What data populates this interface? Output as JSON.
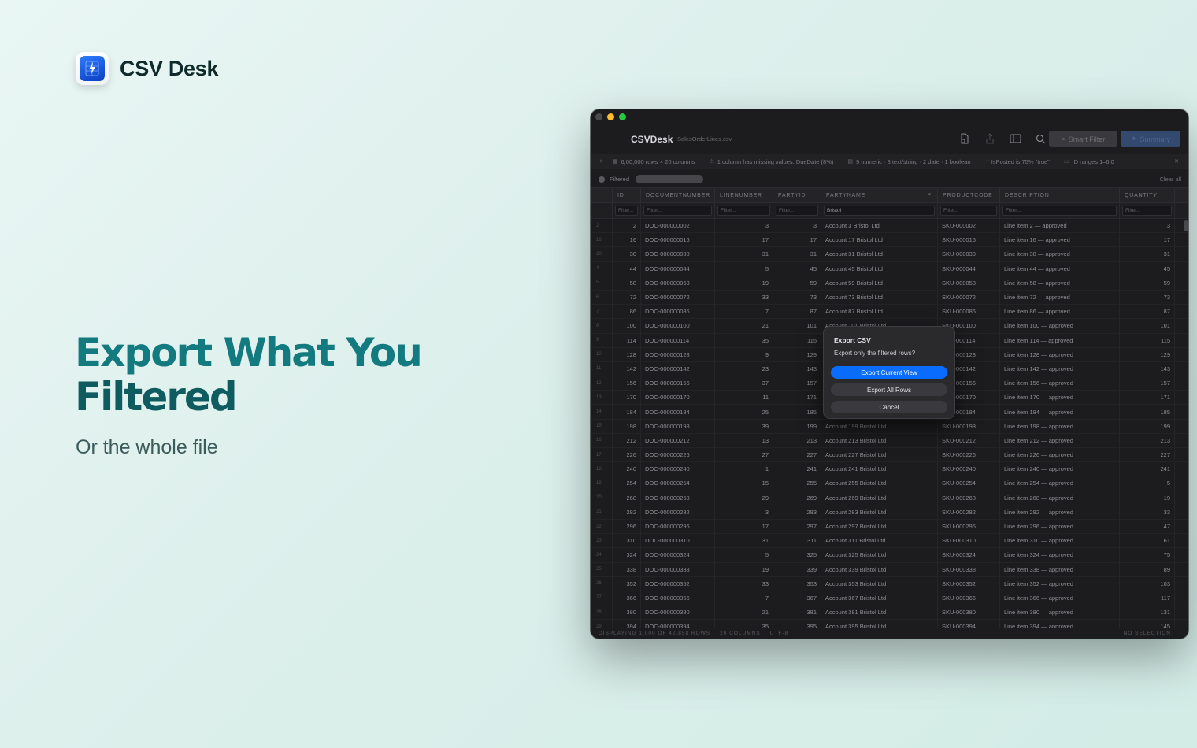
{
  "brand": {
    "name": "CSV Desk",
    "icon": "lightning-spreadsheet-icon"
  },
  "hero": {
    "title_line1": "Export What You",
    "title_line2": "Filtered",
    "subtitle": "Or the whole file"
  },
  "window": {
    "app_title": "CSVDesk",
    "file_name": "SalesOrderLines.csv",
    "toolbar": {
      "smart_filter_label": "Smart Filter",
      "summary_label": "Summary"
    },
    "infobar": [
      {
        "icon": "grid-icon",
        "text": "6,00,000 rows × 20 columns"
      },
      {
        "icon": "warning-icon",
        "text": "1 column has missing values: DueDate (8%)"
      },
      {
        "icon": "type-icon",
        "text": "9 numeric · 8 text/string · 2 date · 1 boolean"
      },
      {
        "icon": "info-icon",
        "text": "IsPosted is 75% \"true\""
      },
      {
        "icon": "range-icon",
        "text": "ID ranges 1–6,0"
      }
    ],
    "filterbar": {
      "label": "Filtered",
      "clear_label": "Clear all"
    },
    "columns": [
      "ID",
      "DOCUMENTNUMBER",
      "LINENUMBER",
      "PARTYID",
      "PARTYNAME",
      "PRODUCTCODE",
      "DESCRIPTION",
      "QUANTITY"
    ],
    "filter_placeholder": "Filter...",
    "partyname_filter": "Bristol",
    "rows": [
      [
        "2",
        "2",
        "DOC-000000002",
        "3",
        "3",
        "Account 3 Bristol Ltd",
        "SKU-000002",
        "Line item 2 — approved",
        "3"
      ],
      [
        "16",
        "16",
        "DOC-000000016",
        "17",
        "17",
        "Account 17 Bristol Ltd",
        "SKU-000016",
        "Line item 16 — approved",
        "17"
      ],
      [
        "30",
        "30",
        "DOC-000000030",
        "31",
        "31",
        "Account 31 Bristol Ltd",
        "SKU-000030",
        "Line item 30 — approved",
        "31"
      ],
      [
        "4",
        "44",
        "DOC-000000044",
        "5",
        "45",
        "Account 45 Bristol Ltd",
        "SKU-000044",
        "Line item 44 — approved",
        "45"
      ],
      [
        "5",
        "58",
        "DOC-000000058",
        "19",
        "59",
        "Account 59 Bristol Ltd",
        "SKU-000058",
        "Line item 58 — approved",
        "59"
      ],
      [
        "6",
        "72",
        "DOC-000000072",
        "33",
        "73",
        "Account 73 Bristol Ltd",
        "SKU-000072",
        "Line item 72 — approved",
        "73"
      ],
      [
        "7",
        "86",
        "DOC-000000086",
        "7",
        "87",
        "Account 87 Bristol Ltd",
        "SKU-000086",
        "Line item 86 — approved",
        "87"
      ],
      [
        "8",
        "100",
        "DOC-000000100",
        "21",
        "101",
        "Account 101 Bristol Ltd",
        "SKU-000100",
        "Line item 100 — approved",
        "101"
      ],
      [
        "9",
        "114",
        "DOC-000000114",
        "35",
        "115",
        "Account 115 Bristol Ltd",
        "SKU-000114",
        "Line item 114 — approved",
        "115"
      ],
      [
        "10",
        "128",
        "DOC-000000128",
        "9",
        "129",
        "Account 129 Bristol Ltd",
        "SKU-000128",
        "Line item 128 — approved",
        "129"
      ],
      [
        "11",
        "142",
        "DOC-000000142",
        "23",
        "143",
        "Account 143 Bristol Ltd",
        "SKU-000142",
        "Line item 142 — approved",
        "143"
      ],
      [
        "12",
        "156",
        "DOC-000000156",
        "37",
        "157",
        "Account 157 Bristol Ltd",
        "SKU-000156",
        "Line item 156 — approved",
        "157"
      ],
      [
        "13",
        "170",
        "DOC-000000170",
        "11",
        "171",
        "Account 171 Bristol Ltd",
        "SKU-000170",
        "Line item 170 — approved",
        "171"
      ],
      [
        "14",
        "184",
        "DOC-000000184",
        "25",
        "185",
        "Account 185 Bristol Ltd",
        "SKU-000184",
        "Line item 184 — approved",
        "185"
      ],
      [
        "15",
        "198",
        "DOC-000000198",
        "39",
        "199",
        "Account 199 Bristol Ltd",
        "SKU-000198",
        "Line item 198 — approved",
        "199"
      ],
      [
        "16",
        "212",
        "DOC-000000212",
        "13",
        "213",
        "Account 213 Bristol Ltd",
        "SKU-000212",
        "Line item 212 — approved",
        "213"
      ],
      [
        "17",
        "226",
        "DOC-000000226",
        "27",
        "227",
        "Account 227 Bristol Ltd",
        "SKU-000226",
        "Line item 226 — approved",
        "227"
      ],
      [
        "18",
        "240",
        "DOC-000000240",
        "1",
        "241",
        "Account 241 Bristol Ltd",
        "SKU-000240",
        "Line item 240 — approved",
        "241"
      ],
      [
        "19",
        "254",
        "DOC-000000254",
        "15",
        "255",
        "Account 255 Bristol Ltd",
        "SKU-000254",
        "Line item 254 — approved",
        "5"
      ],
      [
        "20",
        "268",
        "DOC-000000268",
        "29",
        "269",
        "Account 269 Bristol Ltd",
        "SKU-000268",
        "Line item 268 — approved",
        "19"
      ],
      [
        "21",
        "282",
        "DOC-000000282",
        "3",
        "283",
        "Account 283 Bristol Ltd",
        "SKU-000282",
        "Line item 282 — approved",
        "33"
      ],
      [
        "22",
        "296",
        "DOC-000000296",
        "17",
        "297",
        "Account 297 Bristol Ltd",
        "SKU-000296",
        "Line item 296 — approved",
        "47"
      ],
      [
        "23",
        "310",
        "DOC-000000310",
        "31",
        "311",
        "Account 311 Bristol Ltd",
        "SKU-000310",
        "Line item 310 — approved",
        "61"
      ],
      [
        "24",
        "324",
        "DOC-000000324",
        "5",
        "325",
        "Account 325 Bristol Ltd",
        "SKU-000324",
        "Line item 324 — approved",
        "75"
      ],
      [
        "25",
        "338",
        "DOC-000000338",
        "19",
        "339",
        "Account 339 Bristol Ltd",
        "SKU-000338",
        "Line item 338 — approved",
        "89"
      ],
      [
        "26",
        "352",
        "DOC-000000352",
        "33",
        "353",
        "Account 353 Bristol Ltd",
        "SKU-000352",
        "Line item 352 — approved",
        "103"
      ],
      [
        "27",
        "366",
        "DOC-000000366",
        "7",
        "367",
        "Account 367 Bristol Ltd",
        "SKU-000366",
        "Line item 366 — approved",
        "117"
      ],
      [
        "28",
        "380",
        "DOC-000000380",
        "21",
        "381",
        "Account 381 Bristol Ltd",
        "SKU-000380",
        "Line item 380 — approved",
        "131"
      ],
      [
        "29",
        "394",
        "DOC-000000394",
        "35",
        "395",
        "Account 395 Bristol Ltd",
        "SKU-000394",
        "Line item 394 — approved",
        "145"
      ]
    ],
    "status": {
      "displaying": "DISPLAYING 1,000 OF 42,858 ROWS",
      "columns": "20 COLUMNS",
      "encoding": "UTF-8",
      "selection": "NO SELECTION"
    },
    "dialog": {
      "title": "Export CSV",
      "message": "Export only the filtered rows?",
      "primary_label": "Export Current View",
      "secondary_label": "Export All Rows",
      "cancel_label": "Cancel"
    }
  },
  "colors": {
    "accent": "#137a7f",
    "dialog_primary": "#0a6cff"
  }
}
